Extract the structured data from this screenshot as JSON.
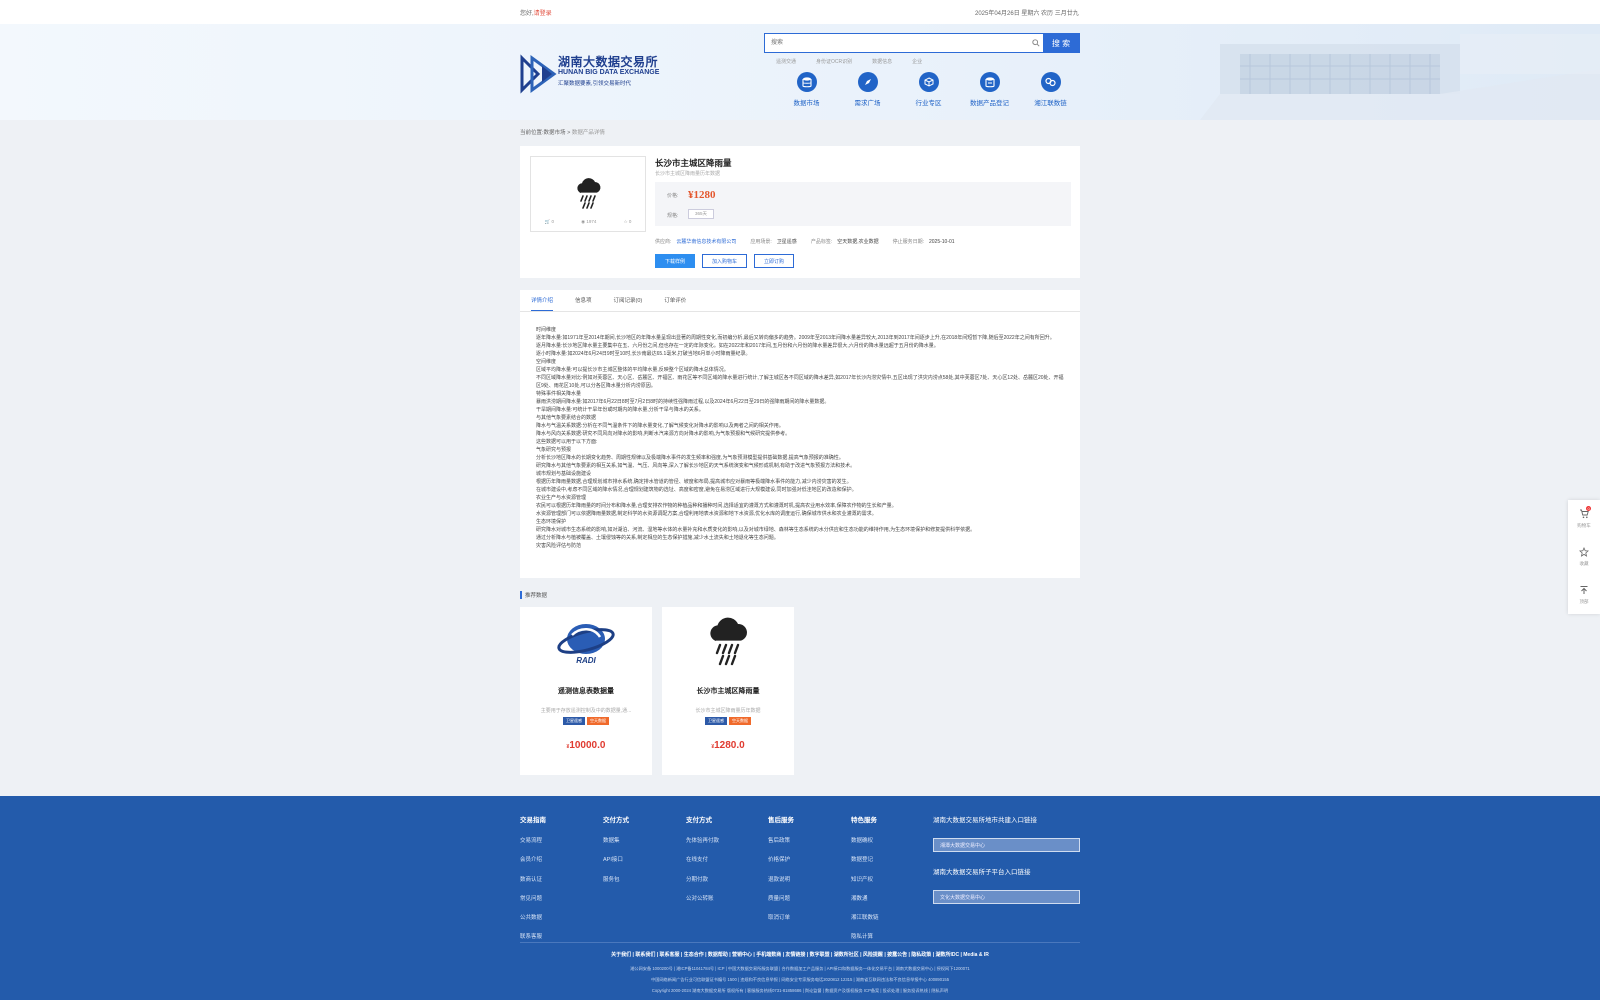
{
  "topbar": {
    "greeting": "您好,",
    "login": "请登录",
    "datetime": "2025年04月26日 星期六 农历 三月廿九"
  },
  "header": {
    "logo_cn": "湖南大数据交易所",
    "logo_en": "HUNAN BIG DATA EXCHANGE",
    "logo_slogan": "汇聚数据要素,引领交易新时代",
    "search_placeholder": "搜索",
    "search_button": "搜 索",
    "hot": [
      "遥测交通",
      "身份证OCR识别",
      "数据信息",
      "企业"
    ],
    "nav": [
      {
        "label": "数据市场",
        "icon": "database-icon"
      },
      {
        "label": "需求广场",
        "icon": "compass-icon"
      },
      {
        "label": "行业专区",
        "icon": "cube-icon"
      },
      {
        "label": "数据产品登记",
        "icon": "register-icon"
      },
      {
        "label": "湘江联数链",
        "icon": "link-icon"
      }
    ]
  },
  "breadcrumb": {
    "prefix": "当前位置:",
    "item1": "数据市场",
    "sep": ">",
    "item2": "数据产品详情"
  },
  "product": {
    "title": "长沙市主城区降雨量",
    "subtitle": "长沙市主城区降雨量历年数据",
    "price_label": "价格:",
    "price": "¥1280",
    "spec_label": "规格:",
    "spec": "365天",
    "stats": {
      "cart": "0",
      "views": "1974",
      "fav": "0"
    },
    "meta": [
      {
        "label": "供应商:",
        "value": "云麓华南信息技术有限公司",
        "link": true
      },
      {
        "label": "应用场景:",
        "value": "卫星遥感",
        "link": false
      },
      {
        "label": "产品标签:",
        "value": "空天数据,农业数据",
        "link": false
      },
      {
        "label": "停止服务日期:",
        "value": "2025-10-01",
        "link": false
      }
    ],
    "actions": [
      "下载样例",
      "加入购物车",
      "立即订购"
    ]
  },
  "tabs": [
    "详情介绍",
    "信息项",
    "订阅记录(0)",
    "订单评价"
  ],
  "detail_lines": [
    "时间维度",
    "逐年降水量:如1971年至2014年期间,长沙地区的年降水量呈现出显著的周期性变化,而初编分析,最后又转向偏多的趋势。2009年至2013年间降水量差异较大,2013年到2017年间逐步上升,在2018年间短暂下降,随后至2022年之间有所回升。",
    "逐月降水量:长沙地区降水量主要集中在五、六月份之间,但也存在一定的年际变化。如在2022年和2017年间,五月份和六月份的降水量差异很大,六月份的降水量远超于五月份的降水量。",
    "逐小时降水量:如2024年6月24日9时至10时,长沙南最达65.1毫米,打破当地6月单小时降雨量纪录。",
    "空间维度",
    "区域平均降水量:可以提长沙市主城区整体的平均降水量,反映整个区域的降水总体情况。",
    "不同区域降水量对比:例如对芙蓉区、天心区、岳麓区、开福区、雨花区等不同区域的降水量进行统计,了解主城区各不同区域的降水差异,如2017年长沙内涝灾情中,五区出现了洪灾内涝点58处,其中芙蓉区7处、天心区12处、岳麓区20处、开福区9处、雨花区10处,可以分各区降水量分析内涝原因。",
    "特殊事件相关降水量",
    "暴雨洪涝期间降水量:如2017年6月22日8时至7月2日8时的持续性强降雨过程,以及2024年6月22日至29日的强降雨期间的降水量数据。",
    "干旱期间降水量:可统计干旱年份或时期内的降水量,分析干旱与降水的关系。",
    "与其他气象要素结合的数据",
    "降水与气温关系数据:分析在不同气温条件下的降水量变化,了解气候变化对降水的影响以及两者之间的相关作用。",
    "降水与风向关系数据:研究不同风向对降水的影响,判断水汽来源方向对降水的影响,为气象预报和气候研究提供参考。",
    "这些数据可以用于以下方面:",
    "气象研究与预报",
    "分析长沙地区降水的长期变化趋势、周期性规律以及极端降水事件的发生频率和强度,为气象预测模型提供基础数据,提高气象预报的准确性。",
    "研究降水与其他气象要素的相互关系,如气温、气压、风向等,深入了解长沙地区的天气系统演变和气候形成机制,有助于改进气象预报方法和技术。",
    "城市规划与基础设施建设",
    "根据历年降雨量数据,合理规划城市排水系统,确定排水管道的管径、坡度和布局,提高城市应对暴雨等极端降水事件的能力,减少内涝灾害的发生。",
    "在城市建设中,考虑不同区域的降水情况,合理规划建筑物的选址、高度和密度,避免在易涝区域进行大规模建设,同时加强对低洼地区的改造和保护。",
    "农业生产与水资源管理",
    "农民可以根据历年降雨量的时间分布和降水量,合理安排农作物的种植品种和播种时间,选择适宜的灌溉方式和灌溉时机,提高农业用水效率,保障农作物的生长和产量。",
    "水资源管理部门可以依据降雨量数据,制定科学的水资源调配方案,合理利用地表水资源和地下水资源,优化水库的调度运行,确保城市供水和农业灌溉的需求。",
    "生态环境保护",
    "研究降水对城市生态系统的影响,如对湖泊、河流、湿地等水体的水量补充和水质变化的影响,以及对城市绿地、森林等生态系统的水分供应和生态功能的维持作用,为生态环境保护和修复提供科学依据。",
    "通过分析降水与植被覆盖、土壤侵蚀等的关系,制定相应的生态保护措施,减少水土流失和土地退化等生态问题。",
    "灾害风险评估与防范"
  ],
  "recommend": {
    "heading": "推荐数据",
    "items": [
      {
        "title": "遥测信息表数据量",
        "desc": "主要用于存放遥测控制及中的数据量,通...",
        "tags": [
          "卫星遥感",
          "空天数据"
        ],
        "currency": "¥",
        "price": "10000.0",
        "icon": "radi-logo-icon"
      },
      {
        "title": "长沙市主城区降雨量",
        "desc": "长沙市主城区降雨量历年数据",
        "tags": [
          "卫星遥感",
          "空天数据"
        ],
        "currency": "¥",
        "price": "1280.0",
        "icon": "rain-cloud-icon"
      }
    ]
  },
  "side": [
    {
      "label": "购物车",
      "icon": "cart-icon",
      "badge": "0"
    },
    {
      "label": "收藏",
      "icon": "star-icon"
    },
    {
      "label": "顶部",
      "icon": "top-icon"
    }
  ],
  "footer": {
    "cols": [
      {
        "h": "交易指南",
        "items": [
          "交易流程",
          "会员介绍",
          "数商认证",
          "常见问题",
          "公共数据",
          "联系客服"
        ]
      },
      {
        "h": "交付方式",
        "items": [
          "数据集",
          "API接口",
          "服务包"
        ]
      },
      {
        "h": "支付方式",
        "items": [
          "先体验再付款",
          "在线支付",
          "分期付款",
          "公对公转账"
        ]
      },
      {
        "h": "售后服务",
        "items": [
          "售后政策",
          "价格保护",
          "退款说明",
          "质量问题",
          "取消订单"
        ]
      },
      {
        "h": "特色服务",
        "items": [
          "数据确权",
          "数据登记",
          "知识产权",
          "湘数通",
          "湘江联数链",
          "隐私计算"
        ]
      }
    ],
    "right": [
      {
        "h": "湖南大数据交易所地市共建入口链接",
        "box": "湘潭大数据交易中心"
      },
      {
        "h": "湖南大数据交易所子平台入口链接",
        "box": "文化大数据交易中心"
      }
    ],
    "links": "关于我们 | 联系我们 | 联系客服 | 生态合作 | 数据帮助 | 营销中心 | 手机端数商 | 友情链接 | 数字联盟 | 湖数所社区 | 风险提醒 | 披露公告 | 隐私政策 | 湖数所IDC | Media & IR",
    "line1": "湘公网安备 1000200号 | 湘ICP备11041784号 | ICP | 中国大数据交易所服务联盟 | 合作数据加工产品服务 | API接口和数据服务一体化交易平台 | 湖南大数据交易中心 | 授权网下1200071",
    "line2": "中国网络新闻广告行业可信联盟证书编号 1500 | 违规和不良信息举报 | 网络安全专家服务电话2020812 12315 | 湖南省互联网违法和不良信息举报中心 400890155",
    "line3": "Copyright 2000-2024 湖南大数据交易所 版权所有 | 客服服务热线0731-81858686 | 舆论监督 | 数据资产及版权服务 ICP备案 | 投诉处理 | 服务投诉热线 | 隐私声明"
  }
}
